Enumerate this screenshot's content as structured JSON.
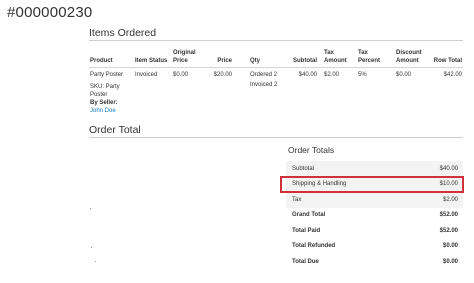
{
  "order": {
    "number": "#000000230"
  },
  "items_section": {
    "title": "Items Ordered",
    "headers": [
      "Product",
      "Item Status",
      "Original Price",
      "Price",
      "Qty",
      "Subtotal",
      "Tax Amount",
      "Tax Percent",
      "Discount Amount",
      "Row Total"
    ],
    "rows": [
      {
        "product": "Party Poster",
        "sku": "SKU: Party Poster",
        "seller_label": "By Seller:",
        "seller_name": "John Doe",
        "status": "Invoiced",
        "original_price": "$0.00",
        "price": "$20.00",
        "qty_ordered": "Ordered 2",
        "qty_invoiced": "Invoiced 2",
        "subtotal": "$40.00",
        "tax_amount": "$2.00",
        "tax_percent": "5%",
        "discount_amount": "$0.00",
        "row_total": "$42.00"
      }
    ]
  },
  "order_total_section": {
    "title": "Order Total"
  },
  "order_totals": {
    "title": "Order Totals",
    "rows": [
      {
        "label": "Subtotal",
        "value": "$40.00"
      },
      {
        "label": "Shipping & Handling",
        "value": "$10.00"
      },
      {
        "label": "Tax",
        "value": "$2.00"
      },
      {
        "label": "Grand Total",
        "value": "$52.00"
      },
      {
        "label": "Total Paid",
        "value": "$52.00"
      },
      {
        "label": "Total Refunded",
        "value": "$0.00"
      },
      {
        "label": "Total Due",
        "value": "$0.00"
      }
    ]
  },
  "colors": {
    "highlight": "#d0313b",
    "link": "#1979c3",
    "shaded_row": "#f3f3f3"
  }
}
